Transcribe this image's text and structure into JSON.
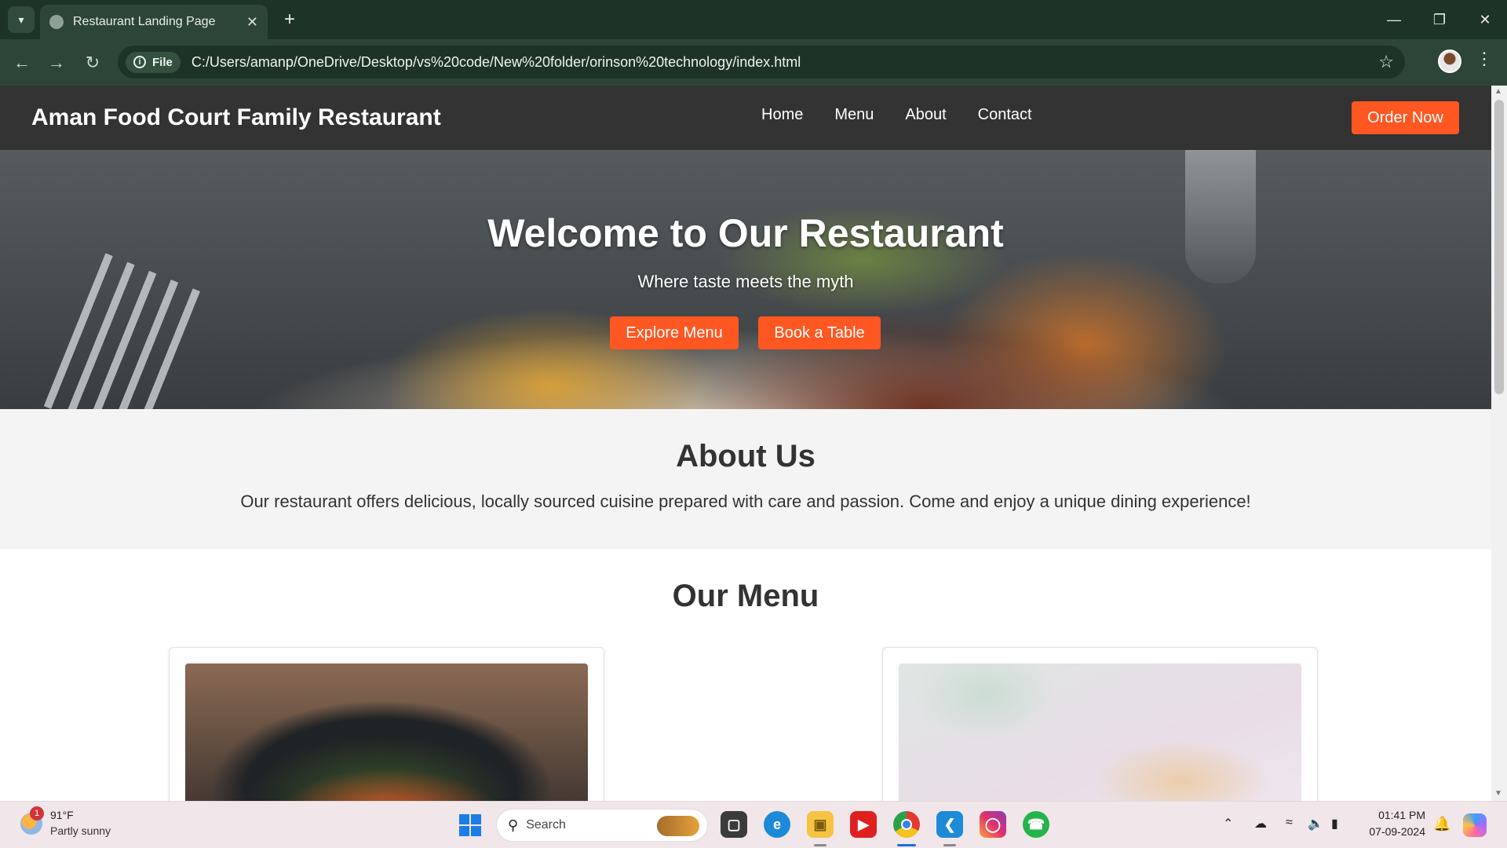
{
  "browser": {
    "tab_title": "Restaurant Landing Page",
    "url_chip": "File",
    "url": "C:/Users/amanp/OneDrive/Desktop/vs%20code/New%20folder/orinson%20technology/index.html"
  },
  "site": {
    "brand": "Aman Food Court Family Restaurant",
    "nav": [
      "Home",
      "Menu",
      "About",
      "Contact"
    ],
    "order_button": "Order Now",
    "hero": {
      "title": "Welcome to Our Restaurant",
      "subtitle": "Where taste meets the myth",
      "buttons": [
        "Explore Menu",
        "Book a Table"
      ]
    },
    "about": {
      "heading": "About Us",
      "text": "Our restaurant offers delicious, locally sourced cuisine prepared with care and passion. Come and enjoy a unique dining experience!"
    },
    "menu": {
      "heading": "Our Menu"
    },
    "accent_color": "#ff5722",
    "header_color": "#333333"
  },
  "taskbar": {
    "weather_badge": "1",
    "weather_temp": "91°F",
    "weather_desc": "Partly sunny",
    "search_placeholder": "Search",
    "time": "01:41 PM",
    "date": "07-09-2024",
    "apps": [
      "start-icon",
      "file-explorer-icon",
      "edge-icon",
      "folder-icon",
      "youtube-icon",
      "chrome-icon",
      "vscode-icon",
      "instagram-icon",
      "whatsapp-icon"
    ]
  }
}
